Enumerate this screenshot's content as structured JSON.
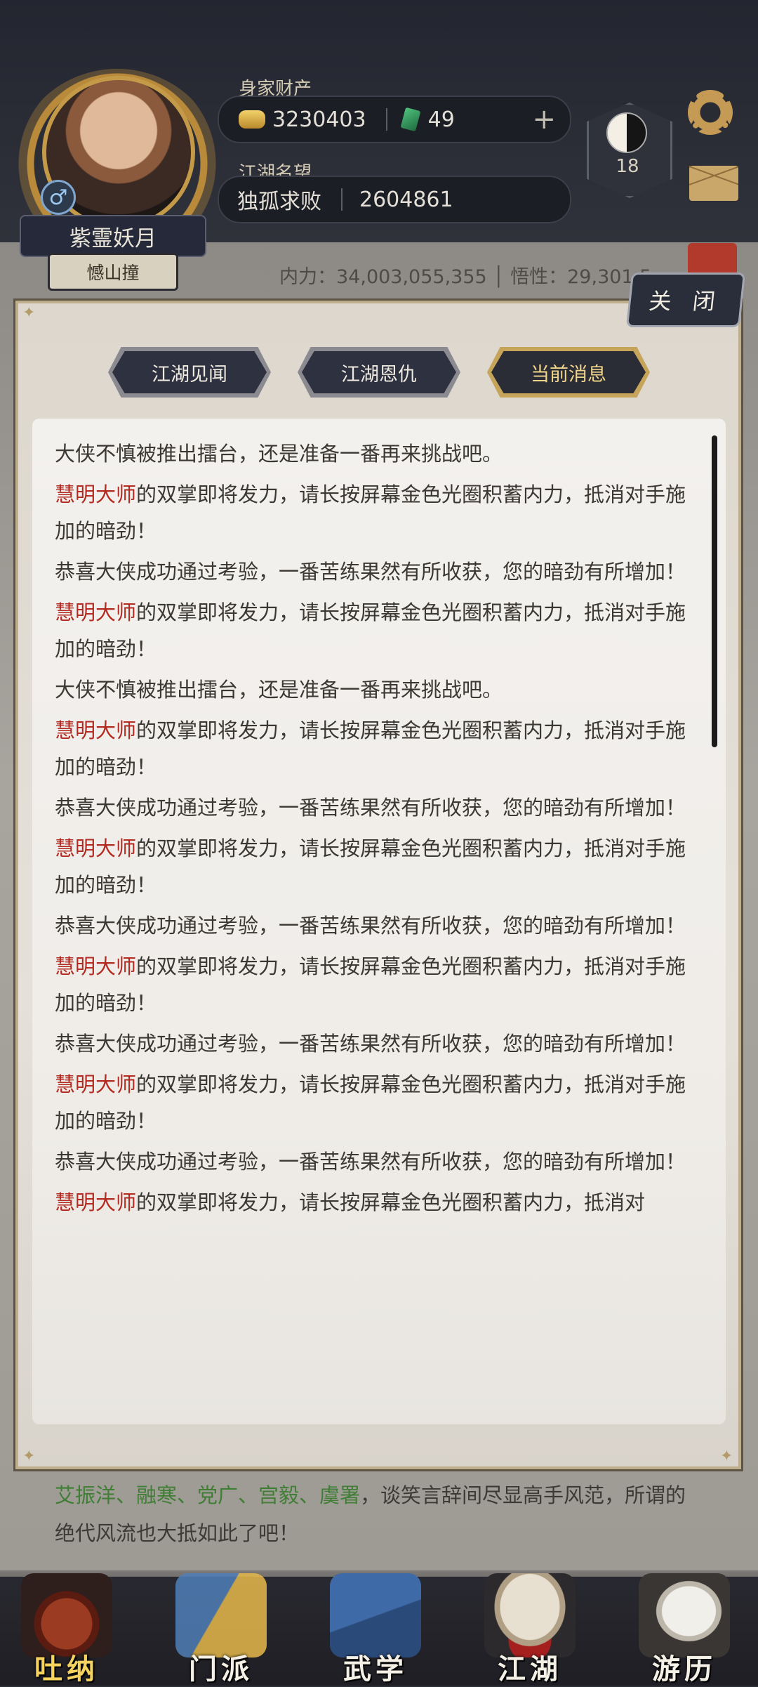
{
  "profile": {
    "name": "紫霊妖月",
    "title": "憾山撞",
    "gender_symbol": "♂"
  },
  "wealth": {
    "label": "身家财产",
    "coins": "3230403",
    "jade": "49",
    "plus": "+"
  },
  "reputation": {
    "label": "江湖名望",
    "rank_name": "独孤求败",
    "value": "2604861"
  },
  "level_badge": {
    "value": "18"
  },
  "power_line": "内力：34,003,055,355 │ 悟性：29,301,5",
  "close_label": "关 闭",
  "tabs": [
    {
      "label": "江湖见闻",
      "active": false
    },
    {
      "label": "江湖恩仇",
      "active": false
    },
    {
      "label": "当前消息",
      "active": true
    }
  ],
  "messages": [
    {
      "highlight": "",
      "text": "大侠不慎被推出擂台，还是准备一番再来挑战吧。"
    },
    {
      "highlight": "慧明大师",
      "text": "的双掌即将发力，请长按屏幕金色光圈积蓄内力，抵消对手施加的暗劲！"
    },
    {
      "highlight": "",
      "text": "恭喜大侠成功通过考验，一番苦练果然有所收获，您的暗劲有所增加！"
    },
    {
      "highlight": "慧明大师",
      "text": "的双掌即将发力，请长按屏幕金色光圈积蓄内力，抵消对手施加的暗劲！"
    },
    {
      "highlight": "",
      "text": "大侠不慎被推出擂台，还是准备一番再来挑战吧。"
    },
    {
      "highlight": "慧明大师",
      "text": "的双掌即将发力，请长按屏幕金色光圈积蓄内力，抵消对手施加的暗劲！"
    },
    {
      "highlight": "",
      "text": "恭喜大侠成功通过考验，一番苦练果然有所收获，您的暗劲有所增加！"
    },
    {
      "highlight": "慧明大师",
      "text": "的双掌即将发力，请长按屏幕金色光圈积蓄内力，抵消对手施加的暗劲！"
    },
    {
      "highlight": "",
      "text": "恭喜大侠成功通过考验，一番苦练果然有所收获，您的暗劲有所增加！"
    },
    {
      "highlight": "慧明大师",
      "text": "的双掌即将发力，请长按屏幕金色光圈积蓄内力，抵消对手施加的暗劲！"
    },
    {
      "highlight": "",
      "text": "恭喜大侠成功通过考验，一番苦练果然有所收获，您的暗劲有所增加！"
    },
    {
      "highlight": "慧明大师",
      "text": "的双掌即将发力，请长按屏幕金色光圈积蓄内力，抵消对手施加的暗劲！"
    },
    {
      "highlight": "",
      "text": "恭喜大侠成功通过考验，一番苦练果然有所收获，您的暗劲有所增加！"
    },
    {
      "highlight": "慧明大师",
      "text": "的双掌即将发力，请长按屏幕金色光圈积蓄内力，抵消对"
    }
  ],
  "story": {
    "names": "艾振洋、融寒、党广、宫毅、虞署",
    "rest": "，谈笑言辞间尽显高手风范，所谓的绝代风流也大抵如此了吧！"
  },
  "nav": [
    {
      "label": "吐纳",
      "icon": "gourd-icon",
      "active": true
    },
    {
      "label": "门派",
      "icon": "banner-icon",
      "active": false
    },
    {
      "label": "武学",
      "icon": "scroll-book-icon",
      "active": false
    },
    {
      "label": "江湖",
      "icon": "bamboo-hat-icon",
      "active": false
    },
    {
      "label": "游历",
      "icon": "horse-icon",
      "active": false
    }
  ],
  "colors": {
    "highlight_name": "#b22a20",
    "story_names": "#3f7e34",
    "active_nav": "#f5d35e",
    "active_tab": "#f1d68a"
  }
}
